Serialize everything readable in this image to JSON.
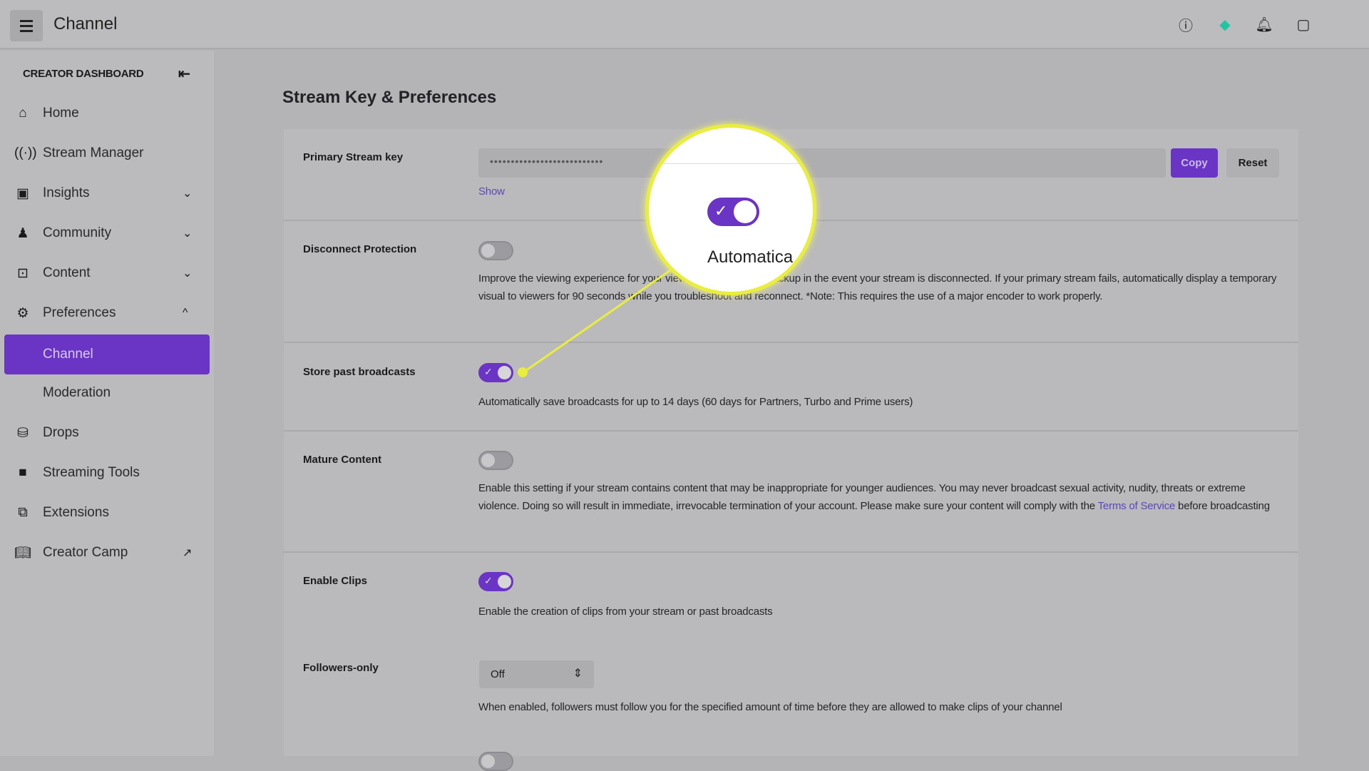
{
  "header": {
    "title": "Channel",
    "icons": [
      "help-icon",
      "prime-loot-icon",
      "notifications-icon",
      "whispers-icon"
    ],
    "accent": "#1ec7a1"
  },
  "sidebar": {
    "section_title": "CREATOR DASHBOARD",
    "items": [
      {
        "label": "Home",
        "icon": "home-icon"
      },
      {
        "label": "Stream Manager",
        "icon": "broadcast-icon"
      },
      {
        "label": "Insights",
        "icon": "insights-icon",
        "expandable": true
      },
      {
        "label": "Community",
        "icon": "community-icon",
        "expandable": true
      },
      {
        "label": "Content",
        "icon": "content-icon",
        "expandable": true
      },
      {
        "label": "Preferences",
        "icon": "gear-icon",
        "expanded": true
      },
      {
        "label": "Channel",
        "active": true
      },
      {
        "label": "Moderation"
      },
      {
        "label": "Drops",
        "icon": "drops-icon"
      },
      {
        "label": "Streaming Tools",
        "icon": "camera-icon"
      },
      {
        "label": "Extensions",
        "icon": "extensions-icon"
      },
      {
        "label": "Creator Camp",
        "icon": "book-icon",
        "external": true
      }
    ]
  },
  "main": {
    "title": "Stream Key & Preferences",
    "stream_key": {
      "label": "Primary Stream key",
      "value": "•••••••••••••••••••••••••••",
      "copy": "Copy",
      "reset": "Reset",
      "show": "Show"
    },
    "disconnect": {
      "label": "Disconnect Protection",
      "on": false,
      "desc": "Improve the viewing experience for your viewers by showing a backup in the event your stream is disconnected. If your primary stream fails, automatically display a temporary visual to viewers for 90 seconds while you troubleshoot and reconnect. *Note: This requires the use of a major encoder to work properly."
    },
    "store": {
      "label": "Store past broadcasts",
      "on": true,
      "desc": "Automatically save broadcasts for up to 14 days (60 days for Partners, Turbo and Prime users)"
    },
    "mature": {
      "label": "Mature Content",
      "on": false,
      "desc_a": "Enable this setting if your stream contains content that may be inappropriate for younger audiences. You may never broadcast sexual activity, nudity, threats or extreme violence. Doing so will result in immediate, irrevocable termination of your account. Please make sure your content will comply with the ",
      "link": "Terms of Service",
      "desc_b": " before broadcasting"
    },
    "clips": {
      "label": "Enable Clips",
      "on": true,
      "desc": "Enable the creation of clips from your stream or past broadcasts"
    },
    "followers": {
      "label": "Followers-only",
      "value": "Off",
      "desc": "When enabled, followers must follow you for the specified amount of time before they are allowed to make clips of your channel"
    }
  },
  "magnifier": {
    "text": "Automatica",
    "toggle_on": true,
    "color": "#e9ee3d"
  }
}
